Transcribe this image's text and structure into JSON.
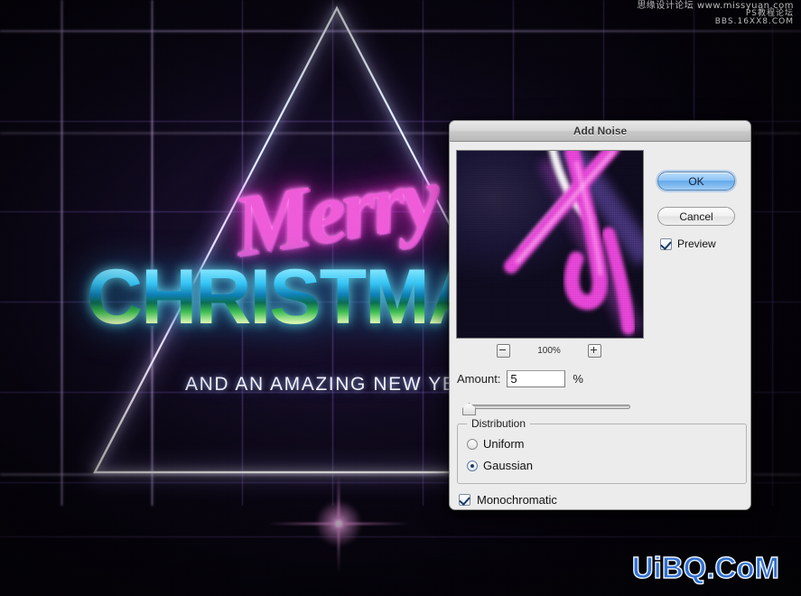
{
  "artwork": {
    "script_text": "Merry",
    "headline_text": "CHRISTMAS",
    "subtitle_text": "AND AN AMAZING NEW YEAR",
    "colors": {
      "neon_pink": "#ef5bd8",
      "neon_cyan": "#37c6f5",
      "grid_purple": "#b58cf0",
      "background": "#0a0614"
    }
  },
  "watermarks": {
    "top_line1": "思缘设计论坛  www.missyuan.com",
    "top_line2": "PS教程论坛",
    "top_line3": "BBS.16XX8.COM",
    "brand": "UiBQ.CoM",
    "brand_color": "#2f6fd0"
  },
  "dialog": {
    "title": "Add Noise",
    "buttons": {
      "ok": "OK",
      "cancel": "Cancel"
    },
    "preview_checkbox": {
      "label": "Preview",
      "checked": true
    },
    "zoom": {
      "minus": "−",
      "level": "100%",
      "plus": "+"
    },
    "amount": {
      "label": "Amount:",
      "value": "5",
      "unit": "%"
    },
    "distribution": {
      "legend": "Distribution",
      "options": [
        {
          "label": "Uniform",
          "selected": false
        },
        {
          "label": "Gaussian",
          "selected": true
        }
      ]
    },
    "monochromatic": {
      "label": "Monochromatic",
      "checked": true
    }
  }
}
